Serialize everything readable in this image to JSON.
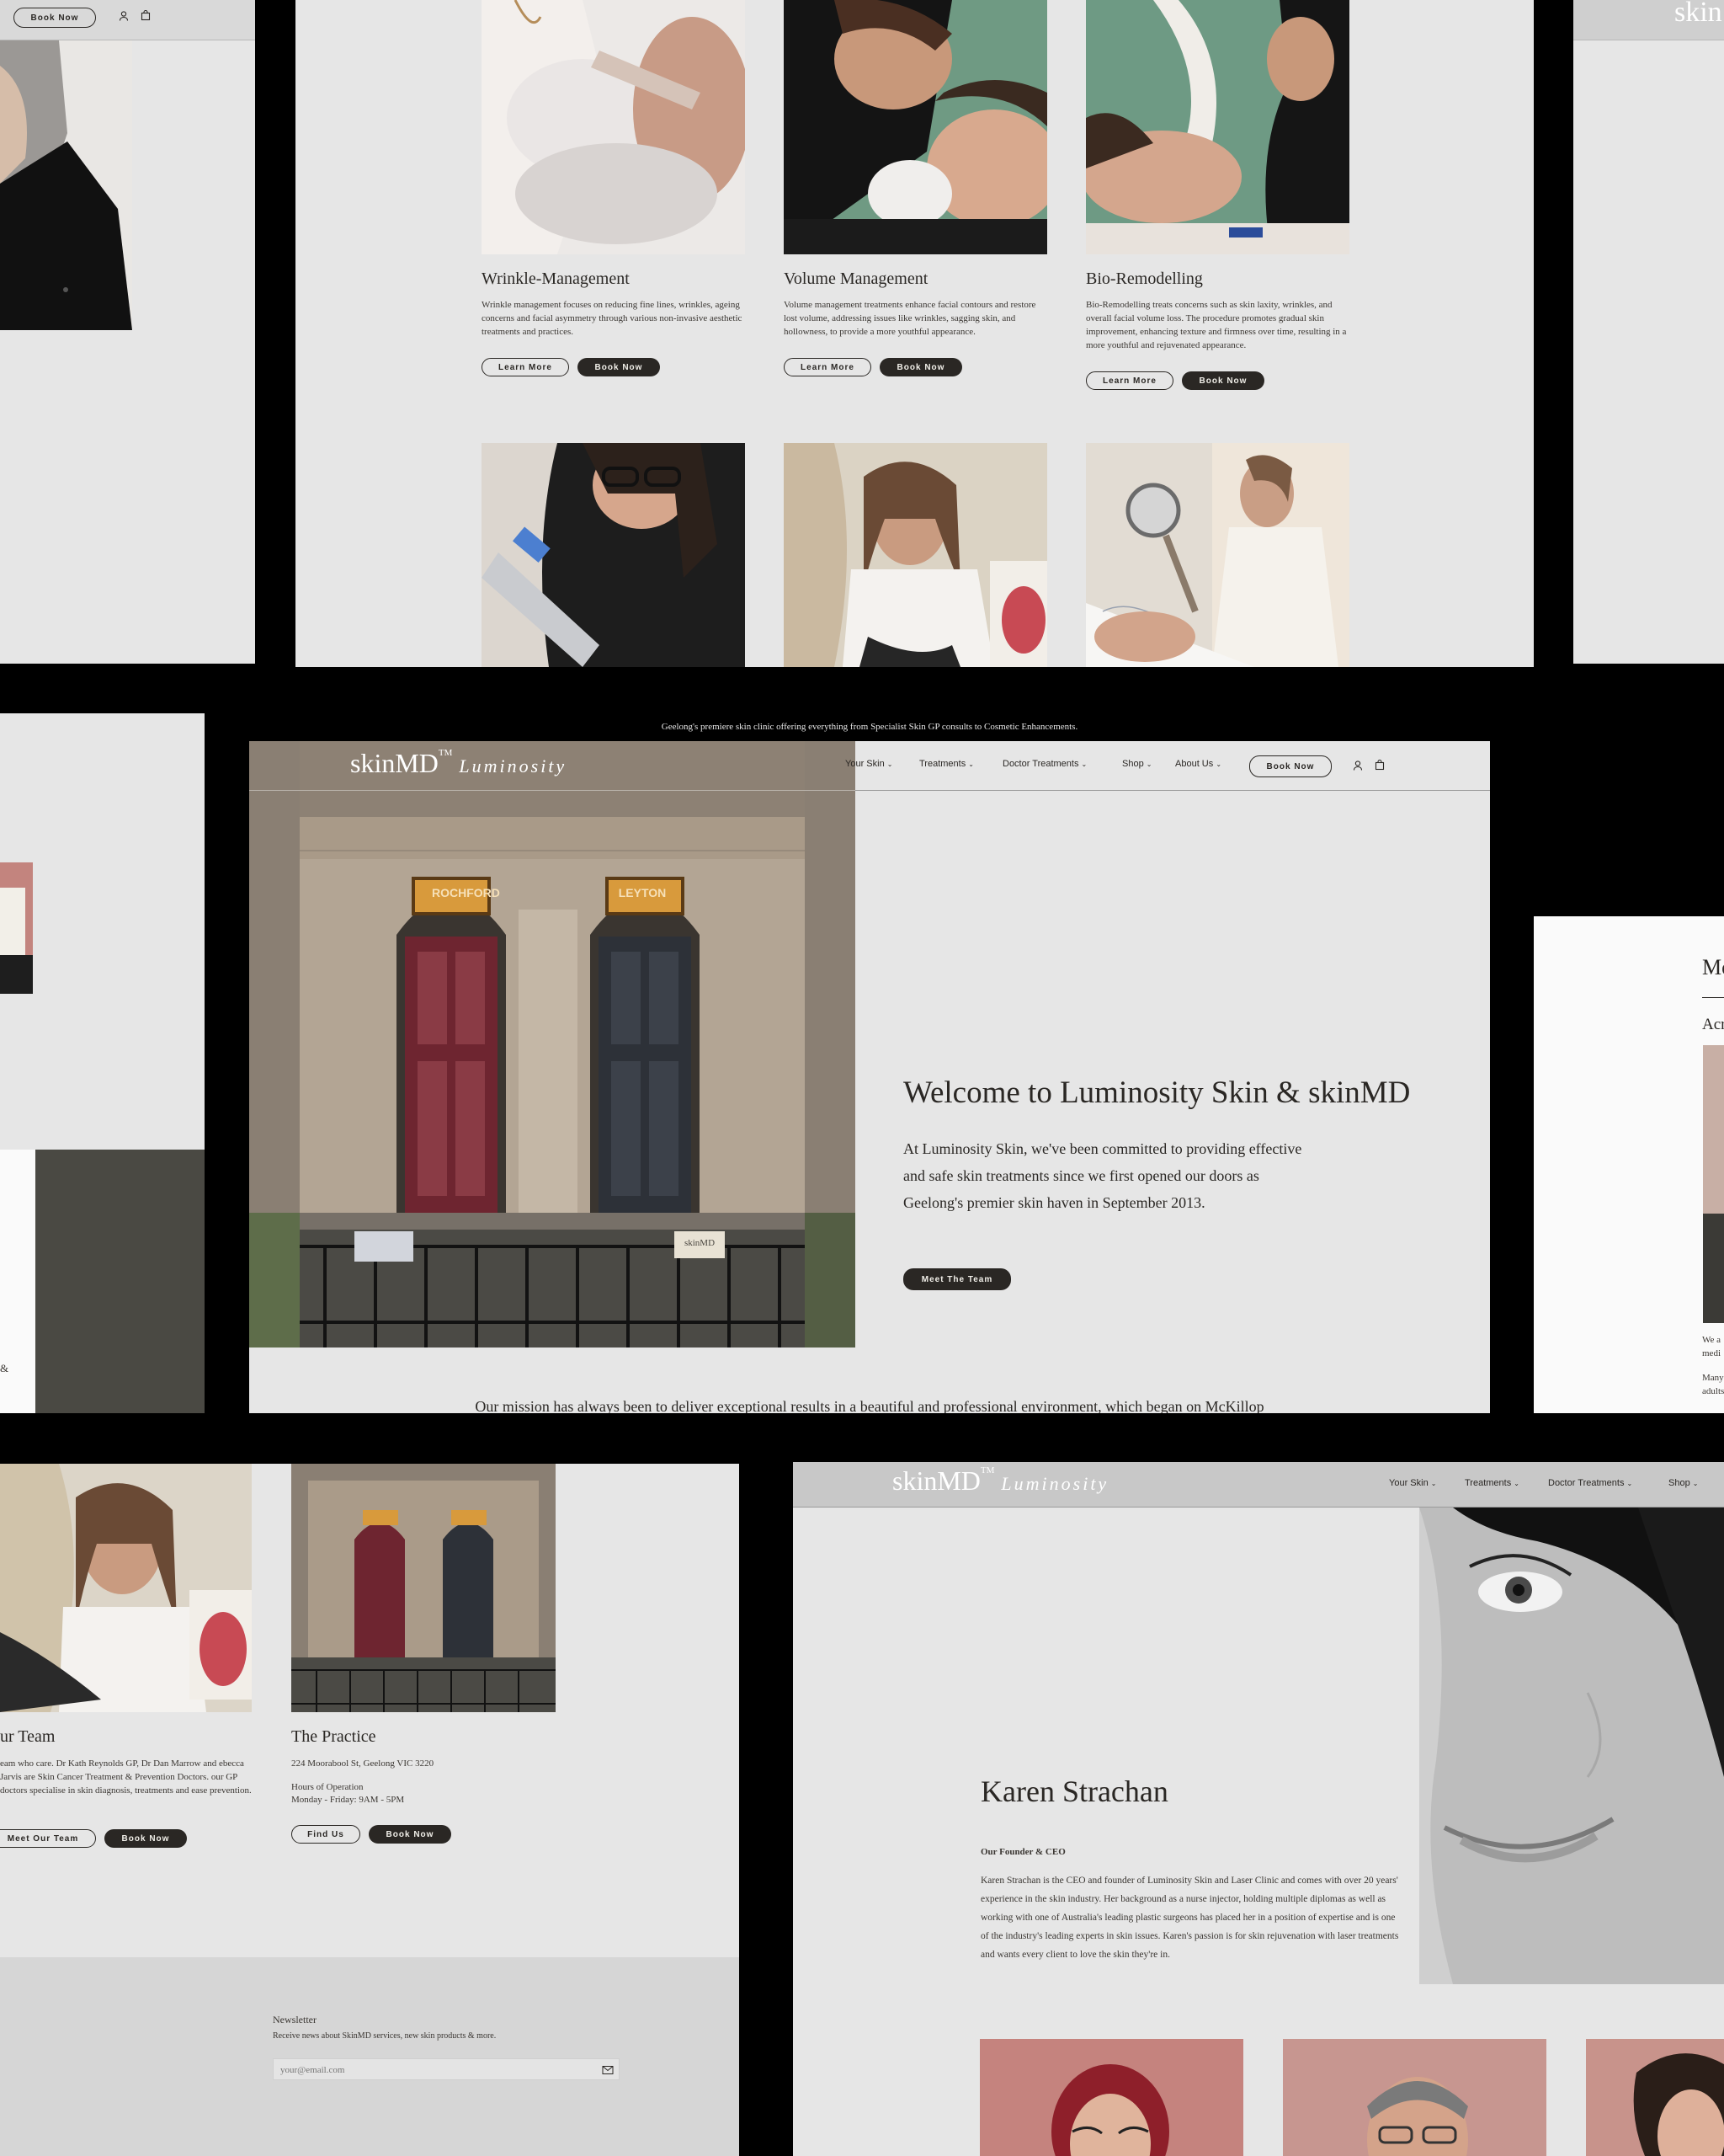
{
  "top_panel": {
    "cards": [
      {
        "title": "Wrinkle-Management",
        "desc": "Wrinkle management focuses on reducing fine lines, wrinkles, ageing concerns and facial asymmetry through various non-invasive aesthetic treatments and practices.",
        "learn": "Learn More",
        "book": "Book Now"
      },
      {
        "title": "Volume Management",
        "desc": "Volume management treatments enhance facial contours and restore lost volume, addressing issues like wrinkles, sagging skin, and hollowness, to provide a more youthful appearance.",
        "learn": "Learn More",
        "book": "Book Now"
      },
      {
        "title": "Bio-Remodelling",
        "desc": "Bio-Remodelling treats concerns such as skin laxity, wrinkles, and overall facial volume loss. The procedure promotes gradual skin improvement, enhancing texture and firmness over time, resulting in a more youthful and rejuvenated appearance.",
        "learn": "Learn More",
        "book": "Book Now"
      }
    ]
  },
  "top_left_panel": {
    "book": "Book Now"
  },
  "top_right_panel": {
    "logo_fragment": "skin"
  },
  "center_panel": {
    "announcement": "Geelong's premiere skin clinic offering everything from Specialist Skin GP consults to Cosmetic Enhancements.",
    "logo_main": "skinMD",
    "logo_tm": "TM",
    "logo_script": "Luminosity",
    "nav": [
      "Your Skin",
      "Treatments",
      "Doctor Treatments",
      "Shop",
      "About Us"
    ],
    "book": "Book Now",
    "heading": "Welcome to Luminosity Skin & skinMD",
    "paragraph": "At Luminosity Skin, we've been committed to providing effective and safe skin treatments since we first opened our doors as Geelong's premier skin haven in September 2013.",
    "cta": "Meet The Team",
    "mission": "Our mission has always been to deliver exceptional results in a beautiful and professional environment, which began on McKillop",
    "door_signs": [
      "ROCHFORD",
      "LEYTON"
    ],
    "plaque": "skinMD"
  },
  "right_mid_panel": {
    "fragment_heading": "Mo",
    "fragment_sub": "Acr",
    "fragment_p1": "We a medi",
    "fragment_p2": "Many adults"
  },
  "left_mid_panel": {
    "amp": "&"
  },
  "bottom_left_panel": {
    "team_title": "ur Team",
    "team_desc": "eam who care. Dr Kath Reynolds GP, Dr Dan Marrow and ebecca Jarvis are Skin Cancer Treatment & Prevention Doctors. our GP doctors specialise in skin diagnosis, treatments and ease prevention.",
    "team_btn1": "Meet Our Team",
    "team_btn2": "Book Now",
    "practice_title": "The Practice",
    "practice_address": "224 Moorabool St, Geelong VIC 3220",
    "practice_hours_label": "Hours of Operation",
    "practice_hours": "Monday - Friday: 9AM - 5PM",
    "practice_btn1": "Find Us",
    "practice_btn2": "Book Now",
    "newsletter_title": "Newsletter",
    "newsletter_desc": "Receive news about SkinMD services, new skin products & more.",
    "newsletter_placeholder": "your@email.com"
  },
  "bottom_right_panel": {
    "logo_main": "skinMD",
    "logo_tm": "TM",
    "logo_script": "Luminosity",
    "nav": [
      "Your Skin",
      "Treatments",
      "Doctor Treatments",
      "Shop"
    ],
    "name": "Karen Strachan",
    "role": "Our Founder & CEO",
    "bio": "Karen Strachan is the CEO and founder of Luminosity Skin and Laser Clinic and comes with over 20 years' experience in the skin industry. Her background as a nurse injector, holding multiple diplomas as well as working with one of Australia's leading plastic surgeons has placed her in a position of expertise and is one of the industry's leading experts in skin issues. Karen's passion is for skin rejuvenation with laser treatments and wants every client to love the skin they're in."
  },
  "colors": {
    "panel": "#e6e6e6",
    "dark": "#2a2724",
    "footer": "#d6d6d6",
    "olive": "#4a4943"
  },
  "icons": [
    "user-icon",
    "cart-icon",
    "chevron-down-icon",
    "mail-icon"
  ]
}
